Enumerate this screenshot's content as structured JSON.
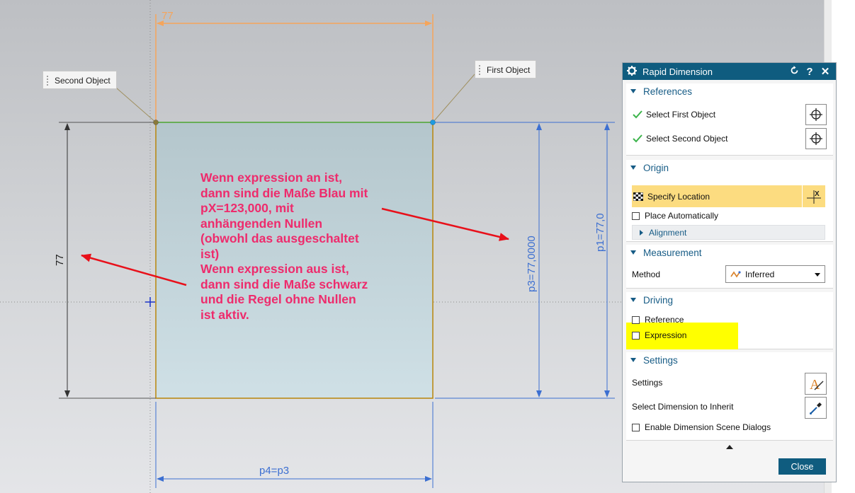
{
  "drawing": {
    "top_dimension": "77",
    "left_dimension": "77",
    "right_dimension_1": "p3=77,0000",
    "right_dimension_2": "p1=77,0",
    "bottom_dimension": "p4=p3",
    "callout_second": "Second Object",
    "callout_first": "First Object",
    "annotation": "Wenn expression an ist,\ndann sind die Maße Blau mit\npX=123,000, mit\nanhängenden Nullen\n(obwohl das ausgeschaltet\nist)\nWenn expression aus ist,\ndann sind die Maße schwarz\nund die Regel ohne Nullen\nist aktiv."
  },
  "colors": {
    "annotation": "#ee2b6c",
    "arrow": "#e8101a",
    "blue_dimension": "#3c6fd1",
    "orange_dimension": "#f5a55b",
    "dialog_header": "#0f5c7f",
    "highlight": "#ffff00",
    "specify_highlight": "#fcdc80"
  },
  "dialog": {
    "title": "Rapid Dimension",
    "icons": [
      "gear-icon",
      "reset-icon",
      "help-icon",
      "close-icon"
    ],
    "help_glyph": "?",
    "close_glyph": "✕",
    "references": {
      "header": "References",
      "first_label": "Select First Object",
      "second_label": "Select Second Object"
    },
    "origin": {
      "header": "Origin",
      "specify_label": "Specify Location",
      "auto_label": "Place Automatically",
      "alignment_label": "Alignment"
    },
    "measurement": {
      "header": "Measurement",
      "method_label": "Method",
      "method_value": "Inferred"
    },
    "driving": {
      "header": "Driving",
      "reference_label": "Reference",
      "expression_label": "Expression",
      "reference_checked": false,
      "expression_checked": false
    },
    "settings": {
      "header": "Settings",
      "settings_label": "Settings",
      "inherit_label": "Select Dimension to Inherit",
      "scene_label": "Enable Dimension Scene Dialogs"
    },
    "close_button": "Close"
  }
}
